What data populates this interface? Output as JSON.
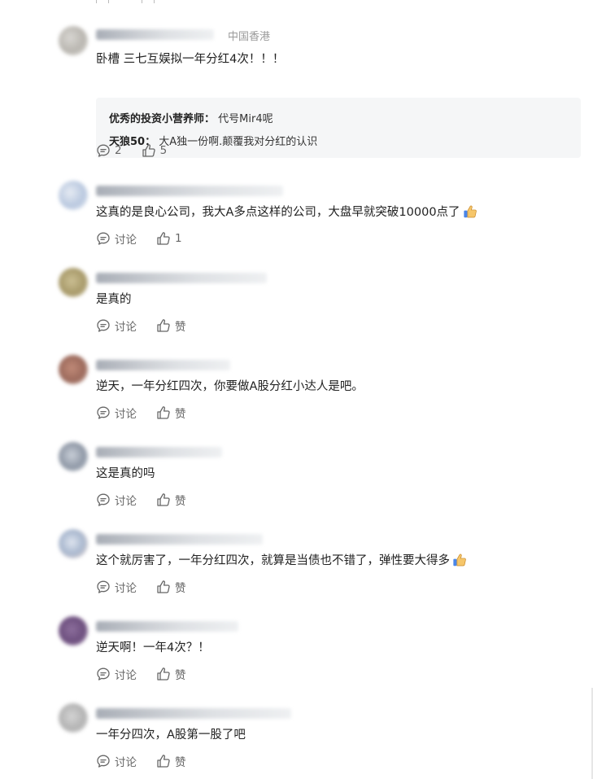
{
  "icons": {
    "comment": "speech-bubble-icon",
    "like": "thumbs-up-icon",
    "emoji": "thumbs-up-emoji"
  },
  "comments": [
    {
      "location": "中国香港",
      "text": "卧槽 三七互娱拟一年分红4次！！！",
      "replies": [
        {
          "author": "优秀的投资小营养师",
          "sep": "：",
          "text": "代号Mir4呢"
        },
        {
          "author": "天狼50",
          "sep": "：",
          "text": "大A独一份啊.颠覆我对分红的认识"
        }
      ],
      "comment_label": "2",
      "like_label": "5"
    },
    {
      "text": "这真的是良心公司，我大A多点这样的公司，大盘早就突破10000点了",
      "comment_label": "讨论",
      "like_label": "1"
    },
    {
      "text": "是真的",
      "comment_label": "讨论",
      "like_label": "赞"
    },
    {
      "text": "逆天，一年分红四次，你要做A股分红小达人是吧。",
      "comment_label": "讨论",
      "like_label": "赞"
    },
    {
      "text": "这是真的吗",
      "comment_label": "讨论",
      "like_label": "赞"
    },
    {
      "text": "这个就厉害了，一年分红四次，就算是当债也不错了，弹性要大得多",
      "comment_label": "讨论",
      "like_label": "赞"
    },
    {
      "text": "逆天啊！一年4次？！",
      "comment_label": "讨论",
      "like_label": "赞"
    },
    {
      "text": "一年分四次，A股第一股了吧",
      "comment_label": "讨论",
      "like_label": "赞"
    }
  ]
}
